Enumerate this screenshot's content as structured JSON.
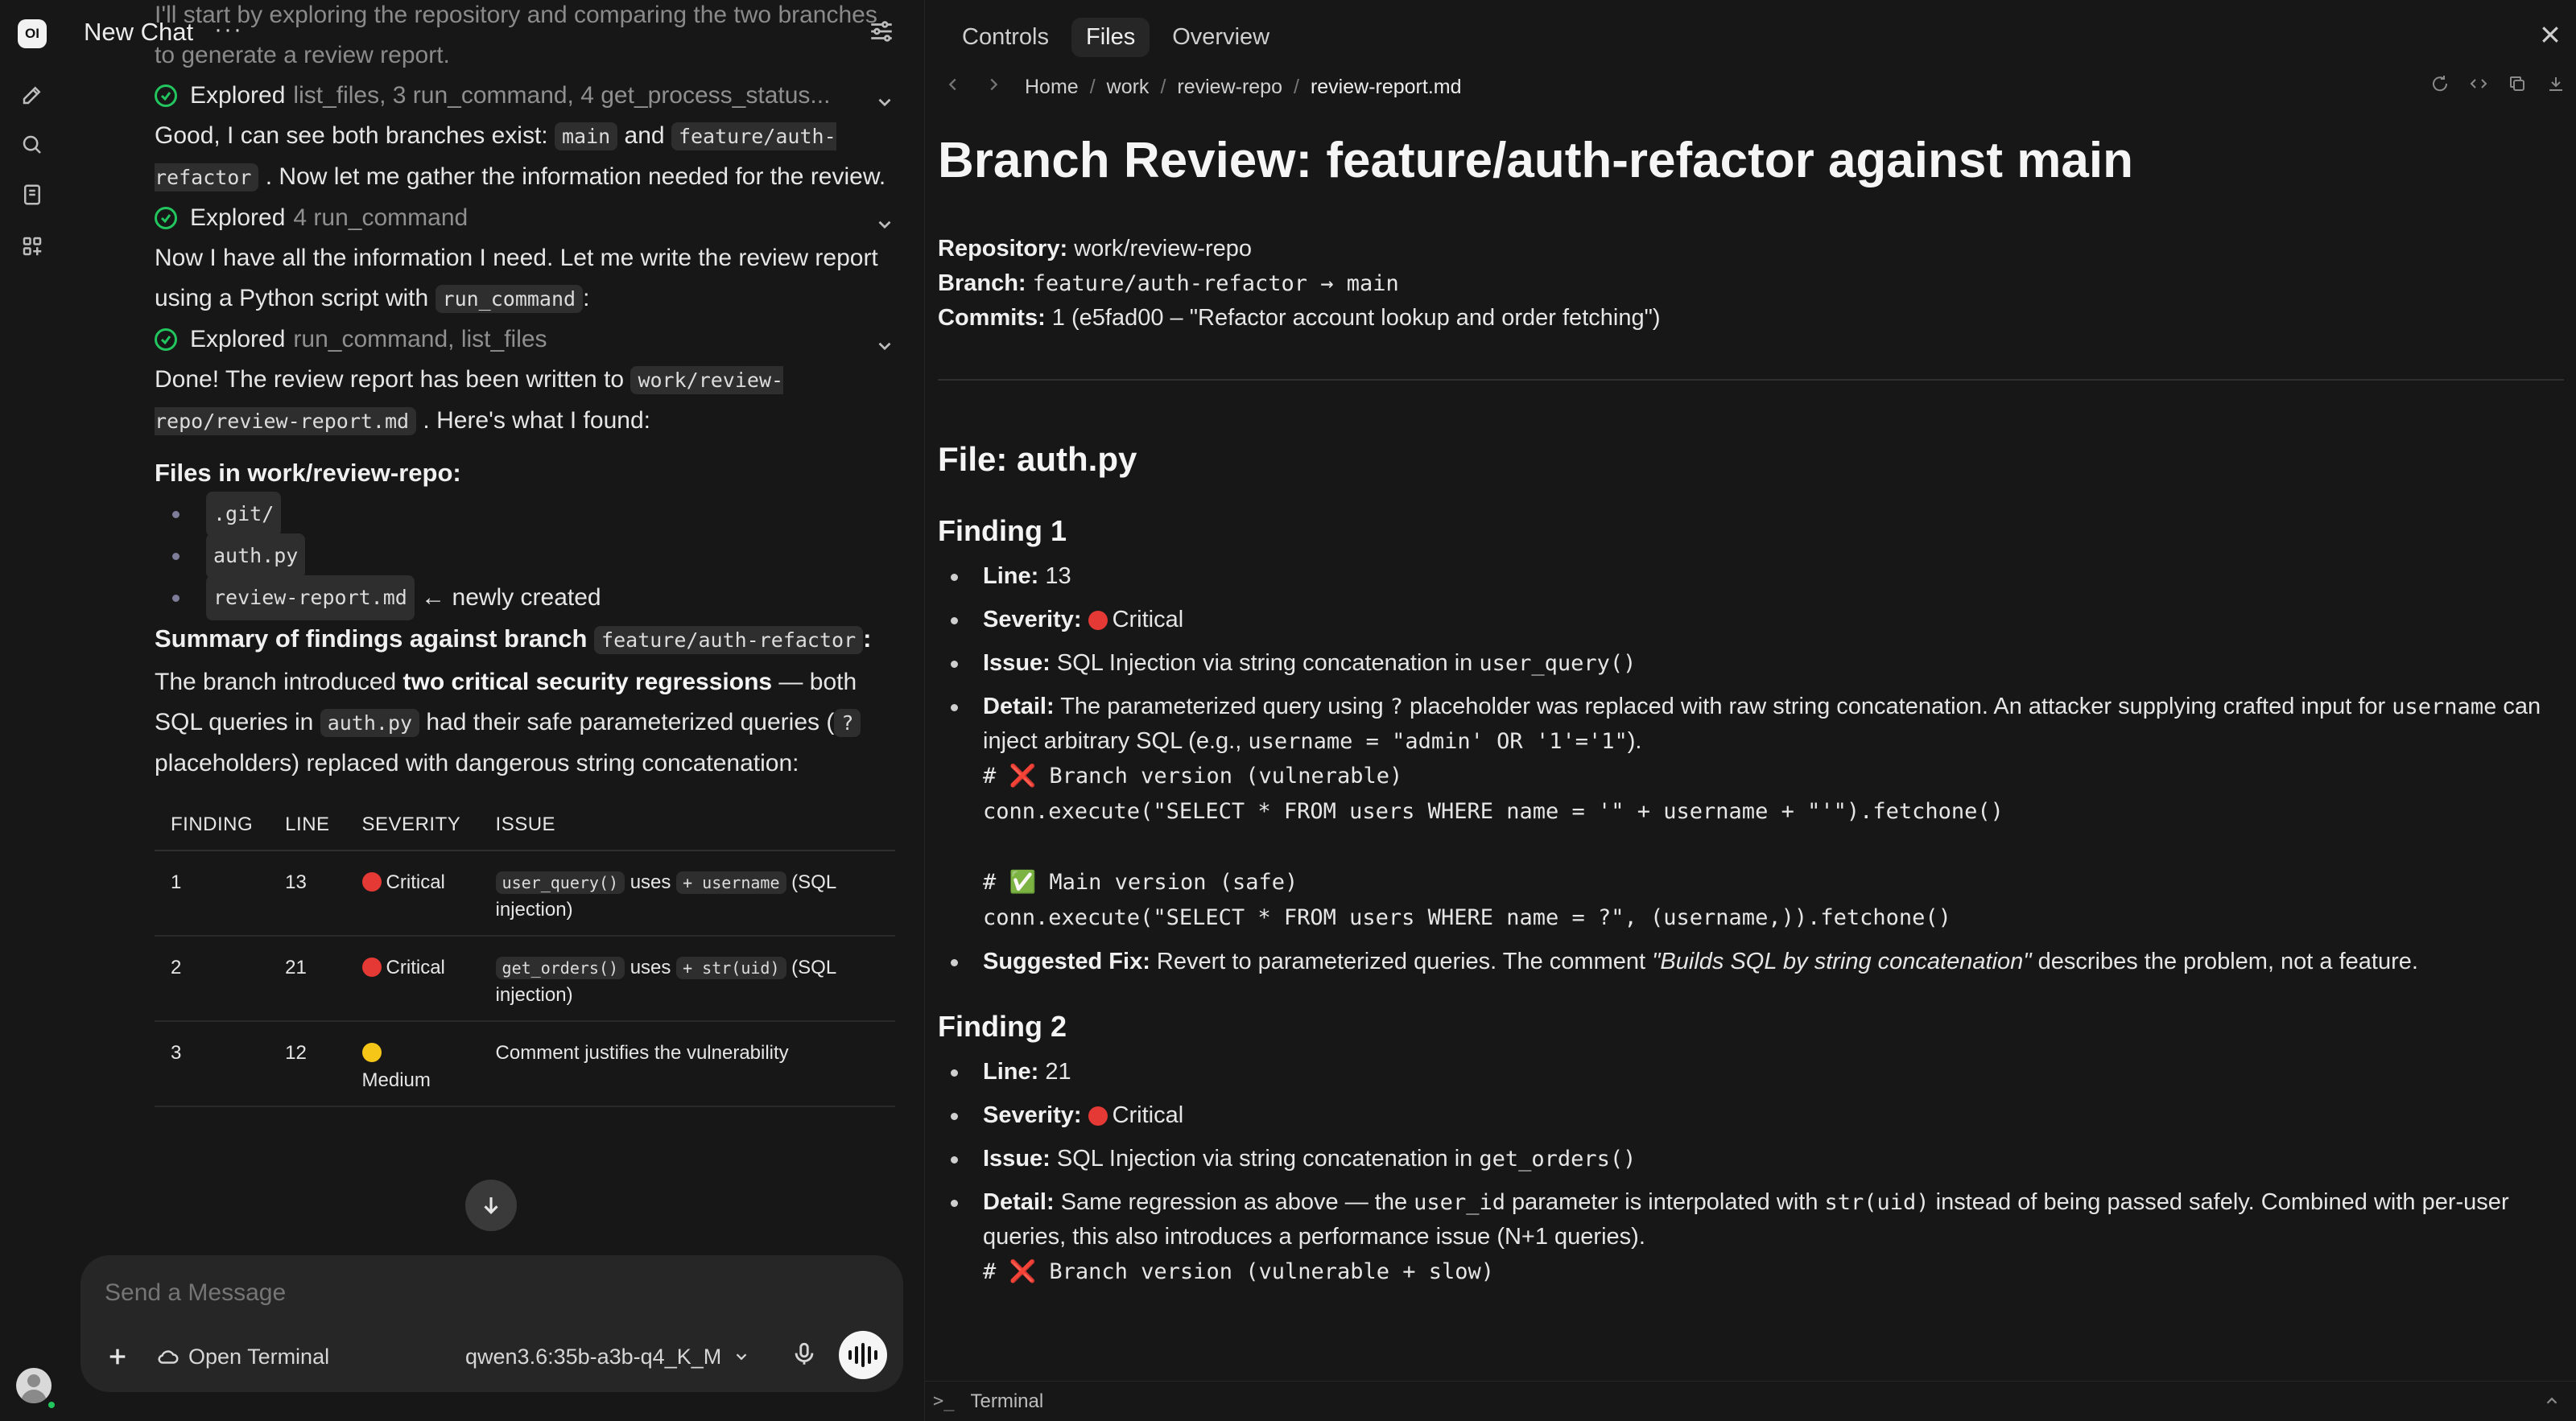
{
  "app": {
    "logo_text": "OI",
    "chat_title": "New Chat",
    "more_glyph": "···"
  },
  "colors": {
    "accent_green": "#22c55e",
    "critical_red": "#e53935",
    "medium_yellow": "#f5c518",
    "background": "#171717",
    "panel": "#262626"
  },
  "icons": {
    "rail": [
      "pencil-icon",
      "search-icon",
      "notebook-icon",
      "grid-icon"
    ],
    "composer": [
      "plus-icon",
      "cloud-icon",
      "chevron-down-icon",
      "mic-icon",
      "voice-wave-icon"
    ]
  },
  "chat": {
    "intro": "I'll start by exploring the repository and comparing the two branches to generate a review report.",
    "explored1": {
      "label": "Explored",
      "detail": "list_files, 3 run_command, 4 get_process_status..."
    },
    "msg1_a": "Good, I can see both branches exist:",
    "msg1_main": "main",
    "msg1_and": "and",
    "msg1_branch": "feature/auth-refactor",
    "msg1_b": ". Now let me gather the information needed for the review.",
    "explored2": {
      "label": "Explored",
      "detail": "4 run_command"
    },
    "msg2_a": "Now I have all the information I need. Let me write the review report using a Python script with",
    "msg2_code": "run_command",
    "msg2_b": ":",
    "explored3": {
      "label": "Explored",
      "detail": "run_command, list_files"
    },
    "msg3_a": "Done! The review report has been written to",
    "msg3_code": "work/review-repo/review-report.md",
    "msg3_b": ". Here's what I found:",
    "files_heading": "Files in work/review-repo:",
    "files": [
      ".git/",
      "auth.py",
      "review-report.md"
    ],
    "new_note": "← newly created",
    "summary_heading": "Summary of findings against branch",
    "summary_branch": "feature/auth-refactor",
    "summary_colon": ":",
    "summary_a": "The branch introduced",
    "summary_bold": "two critical security regressions",
    "summary_b": "— both SQL queries in",
    "summary_code": "auth.py",
    "summary_c": "had their safe parameterized queries (",
    "summary_q": "?",
    "summary_d": "placeholders) replaced with dangerous string concatenation:",
    "table": {
      "headers": [
        "FINDING",
        "LINE",
        "SEVERITY",
        "ISSUE"
      ],
      "rows": [
        {
          "finding": "1",
          "line": "13",
          "severity": "Critical",
          "sev_color": "red",
          "code1": "user_query()",
          "uses": "uses",
          "code2": "+ username",
          "rest": "(SQL injection)"
        },
        {
          "finding": "2",
          "line": "21",
          "severity": "Critical",
          "sev_color": "red",
          "code1": "get_orders()",
          "uses": "uses",
          "code2": "+ str(uid)",
          "rest": "(SQL injection)"
        },
        {
          "finding": "3",
          "line": "12",
          "severity": "Medium",
          "sev_color": "yellow",
          "issue": "Comment justifies the vulnerability"
        }
      ]
    }
  },
  "composer": {
    "placeholder": "Send a Message",
    "open_terminal": "Open Terminal",
    "model": "qwen3.6:35b-a3b-q4_K_M"
  },
  "panel": {
    "tabs": [
      "Controls",
      "Files",
      "Overview"
    ],
    "active_tab": "Files",
    "breadcrumb": [
      "Home",
      "work",
      "review-repo",
      "review-report.md"
    ],
    "terminal_label": "Terminal",
    "terminal_prompt": ">_"
  },
  "report": {
    "title": "Branch Review: feature/auth-refactor against main",
    "repo_label": "Repository:",
    "repo_value": "work/review-repo",
    "branch_label": "Branch:",
    "branch_value": "feature/auth-refactor → main",
    "commits_label": "Commits:",
    "commits_value": "1 (e5fad00 – \"Refactor account lookup and order fetching\")",
    "file_heading": "File: auth.py",
    "f1": {
      "heading": "Finding 1",
      "line_label": "Line:",
      "line_value": "13",
      "sev_label": "Severity:",
      "sev_value": "Critical",
      "issue_label": "Issue:",
      "issue_text": "SQL Injection via string concatenation in",
      "issue_code": "user_query()",
      "detail_label": "Detail:",
      "detail_a": "The parameterized query using",
      "detail_q": "?",
      "detail_b": "placeholder was replaced with raw string concatenation. An attacker supplying crafted input for",
      "detail_code": "username",
      "detail_c": "can inject arbitrary SQL (e.g.,",
      "detail_example": "username = \"admin' OR '1'='1\"",
      "detail_d": ").",
      "code": "# ❌ Branch version (vulnerable)\nconn.execute(\"SELECT * FROM users WHERE name = '\" + username + \"'\").fetchone()\n\n# ✅ Main version (safe)\nconn.execute(\"SELECT * FROM users WHERE name = ?\", (username,)).fetchone()",
      "fix_label": "Suggested Fix:",
      "fix_a": "Revert to parameterized queries. The comment",
      "fix_quote": "\"Builds SQL by string concatenation\"",
      "fix_b": "describes the problem, not a feature."
    },
    "f2": {
      "heading": "Finding 2",
      "line_label": "Line:",
      "line_value": "21",
      "sev_label": "Severity:",
      "sev_value": "Critical",
      "issue_label": "Issue:",
      "issue_text": "SQL Injection via string concatenation in",
      "issue_code": "get_orders()",
      "detail_label": "Detail:",
      "detail_a": "Same regression as above — the",
      "detail_code1": "user_id",
      "detail_b": "parameter is interpolated with",
      "detail_code2": "str(uid)",
      "detail_c": "instead of being passed safely. Combined with per-user queries, this also introduces a performance issue (N+1 queries).",
      "code": "# ❌ Branch version (vulnerable + slow)"
    }
  }
}
